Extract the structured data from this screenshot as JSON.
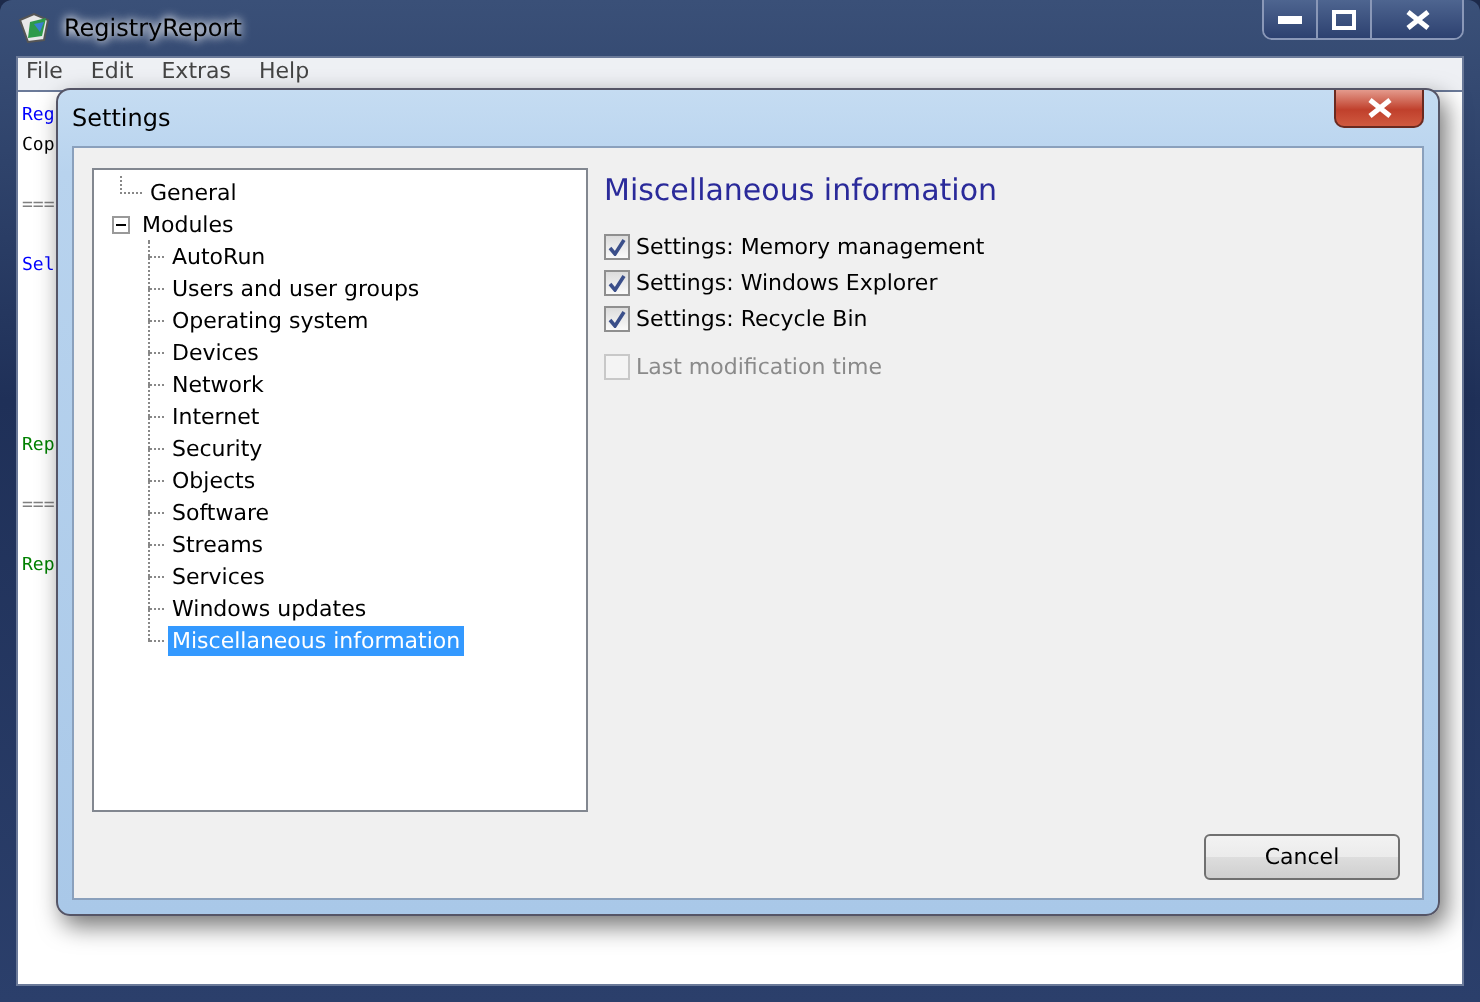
{
  "window": {
    "title": "RegistryReport"
  },
  "menu": [
    "File",
    "Edit",
    "Extras",
    "Help"
  ],
  "report_lines": [
    {
      "kind": "text",
      "text": "Reg",
      "color": "#0000ff"
    },
    {
      "kind": "text",
      "text": "Cop",
      "color": "#000000"
    },
    {
      "kind": "blank"
    },
    {
      "kind": "text",
      "text": "===",
      "color": "#808080"
    },
    {
      "kind": "blank"
    },
    {
      "kind": "text",
      "text": "Sel",
      "color": "#0000ff"
    },
    {
      "kind": "blank"
    },
    {
      "kind": "blank"
    },
    {
      "kind": "blank"
    },
    {
      "kind": "blank"
    },
    {
      "kind": "blank"
    },
    {
      "kind": "text",
      "text": "Rep",
      "color": "#008000"
    },
    {
      "kind": "blank"
    },
    {
      "kind": "text",
      "text": "===",
      "color": "#808080"
    },
    {
      "kind": "blank"
    },
    {
      "kind": "text",
      "text": "Rep",
      "color": "#008000"
    }
  ],
  "dialog": {
    "title": "Settings",
    "tree": [
      {
        "label": "General",
        "selected": false
      },
      {
        "label": "Modules",
        "selected": false,
        "expanded": true,
        "children": [
          {
            "label": "AutoRun",
            "selected": false
          },
          {
            "label": "Users and user groups",
            "selected": false
          },
          {
            "label": "Operating system",
            "selected": false
          },
          {
            "label": "Devices",
            "selected": false
          },
          {
            "label": "Network",
            "selected": false
          },
          {
            "label": "Internet",
            "selected": false
          },
          {
            "label": "Security",
            "selected": false
          },
          {
            "label": "Objects",
            "selected": false
          },
          {
            "label": "Software",
            "selected": false
          },
          {
            "label": "Streams",
            "selected": false
          },
          {
            "label": "Services",
            "selected": false
          },
          {
            "label": "Windows updates",
            "selected": false
          },
          {
            "label": "Miscellaneous information",
            "selected": true
          }
        ]
      }
    ],
    "heading": "Miscellaneous information",
    "options": [
      {
        "label": "Settings: Memory management",
        "checked": true,
        "disabled": false
      },
      {
        "label": "Settings: Windows Explorer",
        "checked": true,
        "disabled": false
      },
      {
        "label": "Settings: Recycle Bin",
        "checked": true,
        "disabled": false
      },
      {
        "label": "Last modification time",
        "checked": false,
        "disabled": true
      }
    ],
    "buttons": [
      "Cancel"
    ]
  }
}
